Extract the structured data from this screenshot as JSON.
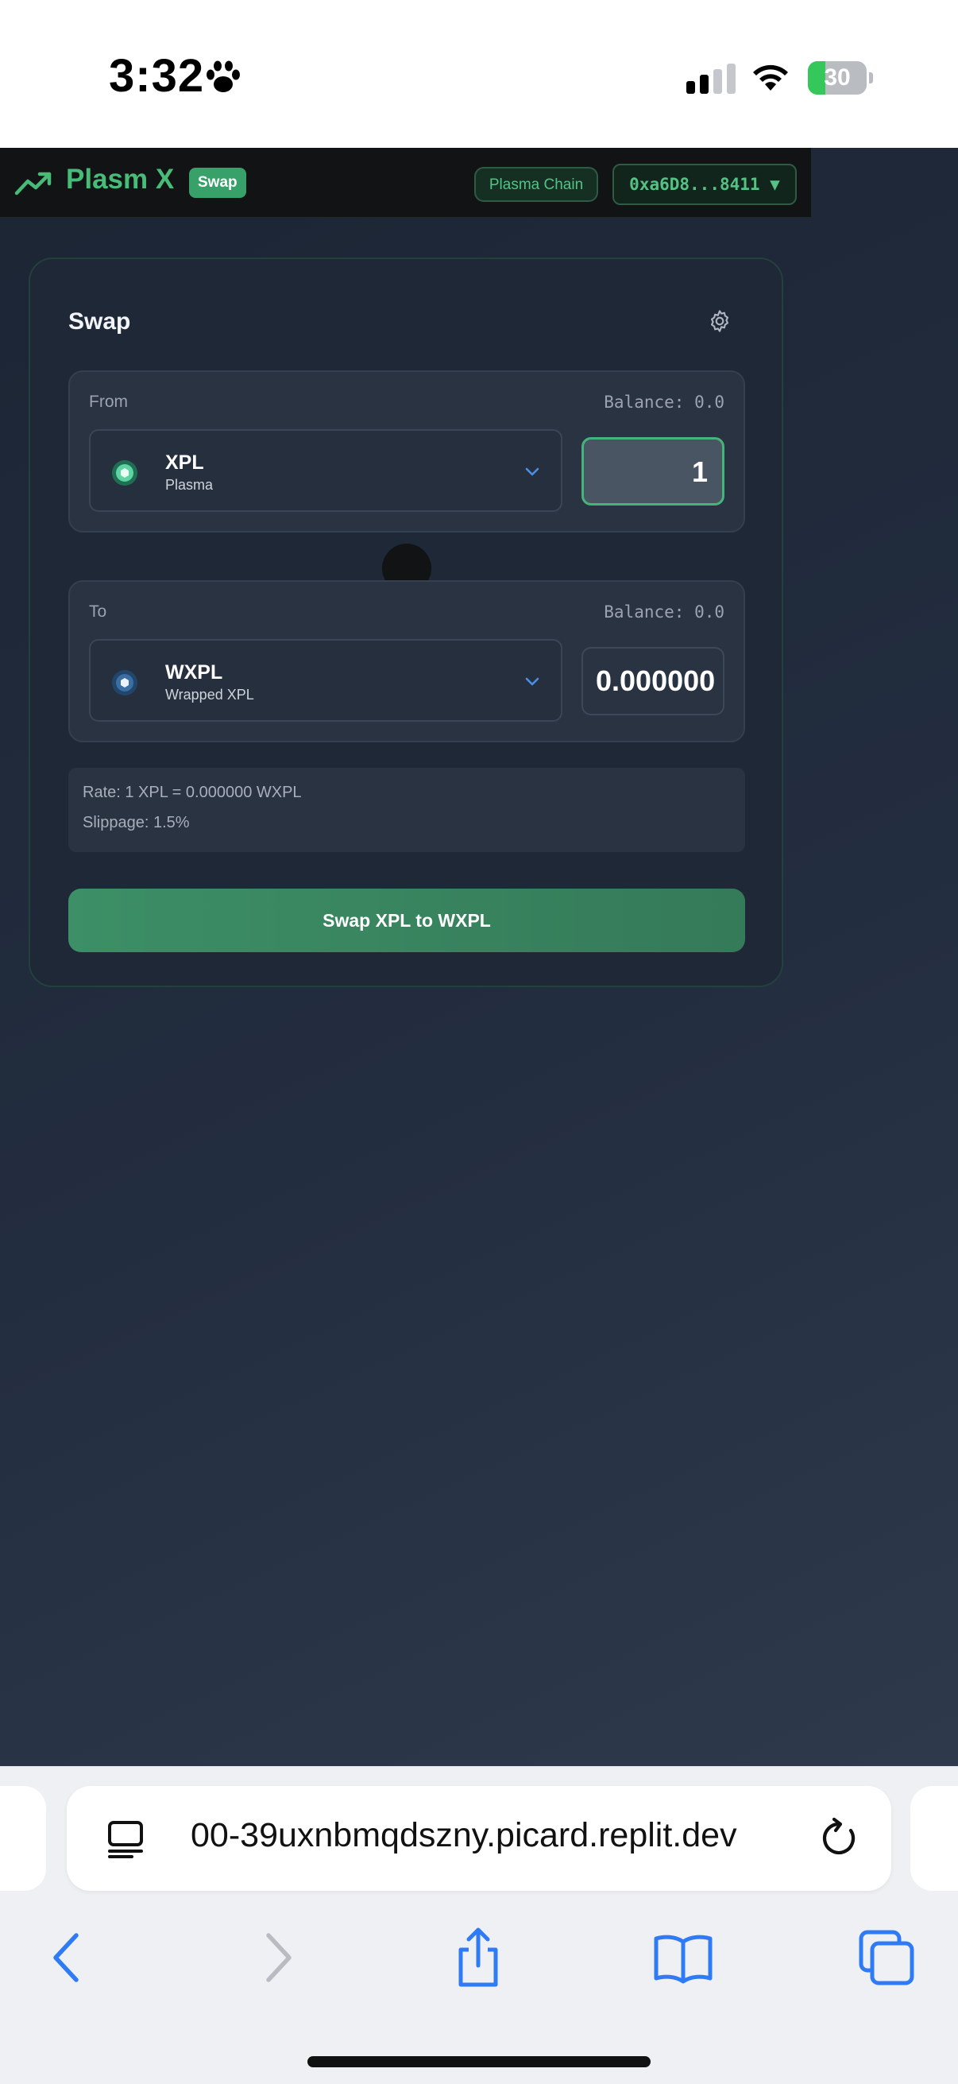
{
  "status_bar": {
    "time": "3:32",
    "battery_text": "30",
    "battery_level": 0.3
  },
  "app": {
    "brand": "Plasm X",
    "badge": "Swap",
    "chain": "Plasma Chain",
    "wallet": "0xa6D8...8411 ▼",
    "accent_color": "#48bb78"
  },
  "swap": {
    "title": "Swap",
    "from": {
      "label": "From",
      "balance": "Balance: 0.0",
      "symbol": "XPL",
      "name": "Plasma",
      "amount": "1",
      "icon": "xpl-token-icon"
    },
    "to": {
      "label": "To",
      "balance": "Balance: 0.0",
      "symbol": "WXPL",
      "name": "Wrapped XPL",
      "amount": "0.000000",
      "icon": "wxpl-token-icon"
    },
    "rate": "Rate: 1 XPL = 0.000000 WXPL",
    "slippage": "Slippage: 1.5%",
    "button": "Swap XPL to WXPL"
  },
  "browser": {
    "url": "00-39uxnbmqdszny.picard.replit.dev",
    "toolbar_icons": [
      "back-icon",
      "forward-icon",
      "share-icon",
      "bookmarks-icon",
      "tabs-icon"
    ]
  }
}
